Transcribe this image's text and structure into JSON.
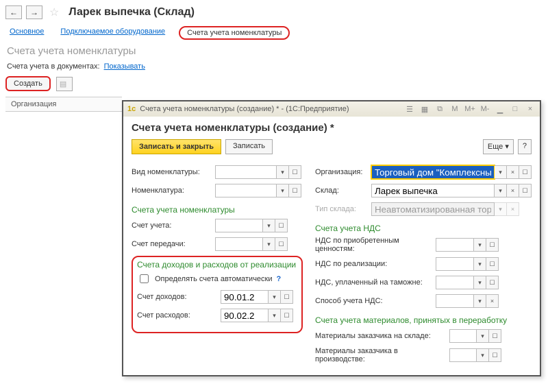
{
  "nav": {
    "back": "←",
    "forward": "→"
  },
  "star": "☆",
  "page_title": "Ларек выпечка (Склад)",
  "tabs": {
    "main": "Основное",
    "equip": "Подключаемое оборудование",
    "accounts": "Счета учета номенклатуры"
  },
  "subhead": "Счета учета номенклатуры",
  "doc_show": {
    "label": "Счета учета в документах:",
    "link": "Показывать"
  },
  "toolbar": {
    "create": "Создать"
  },
  "grid": {
    "col_org": "Организация"
  },
  "dialog": {
    "title": "Счета учета номенклатуры (создание) * - (1С:Предприятие)",
    "head": "Счета учета номенклатуры (создание) *",
    "save_close": "Записать и закрыть",
    "save": "Записать",
    "more": "Еще",
    "help": "?",
    "left": {
      "type_label": "Вид номенклатуры:",
      "type_value": "",
      "nom_label": "Номенклатура:",
      "nom_value": "",
      "sec_acc": "Счета учета номенклатуры",
      "acc_label": "Счет учета:",
      "acc_value": "",
      "transfer_label": "Счет передачи:",
      "transfer_value": "",
      "sec_income": "Счета доходов и расходов от реализации",
      "auto_chk": "Определять счета автоматически",
      "income_label": "Счет доходов:",
      "income_value": "90.01.2",
      "expense_label": "Счет расходов:",
      "expense_value": "90.02.2"
    },
    "right": {
      "org_label": "Организация:",
      "org_value": "Торговый дом \"Комплексный\" ООО",
      "wh_label": "Склад:",
      "wh_value": "Ларек выпечка",
      "whtype_label": "Тип склада:",
      "whtype_value": "Неавтоматизированная торговая точка",
      "sec_vat": "Счета учета НДС",
      "vat1_label": "НДС по приобретенным ценностям:",
      "vat1_value": "",
      "vat2_label": "НДС по реализации:",
      "vat2_value": "",
      "vat3_label": "НДС, уплаченный на таможне:",
      "vat3_value": "",
      "vat4_label": "Способ учета НДС:",
      "vat4_value": "",
      "sec_mat": "Счета учета материалов, принятых в переработку",
      "mat1_label": "Материалы заказчика на складе:",
      "mat1_value": "",
      "mat2_label": "Материалы заказчика в производстве:",
      "mat2_value": ""
    }
  },
  "icons": {
    "dropdown": "▾",
    "close": "×",
    "open": "☐",
    "yc": "◫"
  }
}
